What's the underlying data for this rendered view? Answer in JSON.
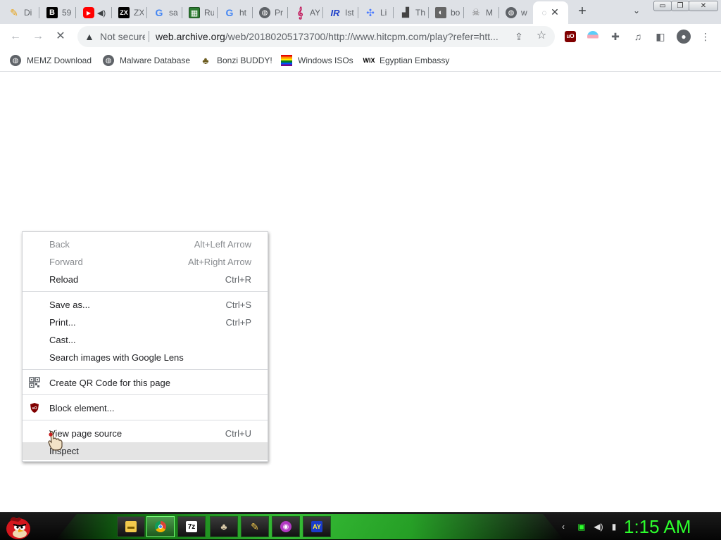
{
  "tabs": [
    {
      "label": "Di",
      "icon": "pencil-icon",
      "color": "#e8a317"
    },
    {
      "label": "59",
      "icon": "b-logo-icon",
      "color": "#000000"
    },
    {
      "label": "",
      "icon": "youtube-icon",
      "color": "#ff0000"
    },
    {
      "label": "ZX",
      "icon": "zx-icon",
      "color": "#000000"
    },
    {
      "label": "sa",
      "icon": "google-icon",
      "color": "#4285f4"
    },
    {
      "label": "Ru",
      "icon": "map-icon",
      "color": "#2e7d32"
    },
    {
      "label": "ht",
      "icon": "google-icon",
      "color": "#4285f4"
    },
    {
      "label": "Pr",
      "icon": "globe-icon",
      "color": "#5f6368"
    },
    {
      "label": "AY",
      "icon": "music-icon",
      "color": "#c2185b"
    },
    {
      "label": "Ist",
      "icon": "ir-logo-icon",
      "color": "#1a3cc9"
    },
    {
      "label": "Li",
      "icon": "link-icon",
      "color": "#4d7cfe"
    },
    {
      "label": "Th",
      "icon": "chart-icon",
      "color": "#444444"
    },
    {
      "label": "bo",
      "icon": "photo-icon",
      "color": "#666666"
    },
    {
      "label": "M",
      "icon": "skull-icon",
      "color": "#777777"
    },
    {
      "label": "w",
      "icon": "globe-icon",
      "color": "#5f6368"
    },
    {
      "label": "",
      "icon": "loading-icon",
      "color": "#9aa0a6"
    }
  ],
  "window_controls": {
    "minimize": "▭",
    "restore": "❐",
    "close": "✕"
  },
  "toolbar": {
    "not_secure": "Not secure",
    "url_host": "web.archive.org",
    "url_path": "/web/20180205173700/http://www.hitcpm.com/play?refer=htt..."
  },
  "bookmarks": [
    {
      "label": "MEMZ Download",
      "icon": "globe-icon"
    },
    {
      "label": "Malware Database",
      "icon": "globe-icon"
    },
    {
      "label": "Bonzi BUDDY!",
      "icon": "bonzi-icon"
    },
    {
      "label": "Windows ISOs",
      "icon": "rainbow-flag-icon"
    },
    {
      "label": "Egyptian Embassy",
      "icon": "wix-icon"
    }
  ],
  "context_menu": {
    "items": [
      {
        "label": "Back",
        "shortcut": "Alt+Left Arrow"
      },
      {
        "label": "Forward",
        "shortcut": "Alt+Right Arrow"
      },
      {
        "label": "Reload",
        "shortcut": "Ctrl+R"
      },
      {
        "label": "Save as...",
        "shortcut": "Ctrl+S"
      },
      {
        "label": "Print...",
        "shortcut": "Ctrl+P"
      },
      {
        "label": "Cast...",
        "shortcut": ""
      },
      {
        "label": "Search images with Google Lens",
        "shortcut": ""
      },
      {
        "label": "Create QR Code for this page",
        "shortcut": ""
      },
      {
        "label": "Block element...",
        "shortcut": ""
      },
      {
        "label": "View page source",
        "shortcut": "Ctrl+U"
      },
      {
        "label": "Inspect",
        "shortcut": ""
      }
    ]
  },
  "taskbar": {
    "wix_text": "WIX",
    "apps": [
      {
        "icon": "folder-icon",
        "text": ""
      },
      {
        "icon": "chrome-icon",
        "text": ""
      },
      {
        "icon": "7zip-icon",
        "text": "7z"
      },
      {
        "icon": "bonzi-icon",
        "text": ""
      },
      {
        "icon": "pencil-icon",
        "text": ""
      },
      {
        "icon": "disc-icon",
        "text": ""
      },
      {
        "icon": "ay-icon",
        "text": "AY"
      }
    ],
    "clock": "1:15 AM"
  },
  "colors": {
    "accent_green": "#2cff2c",
    "ublock_red": "#800000"
  }
}
